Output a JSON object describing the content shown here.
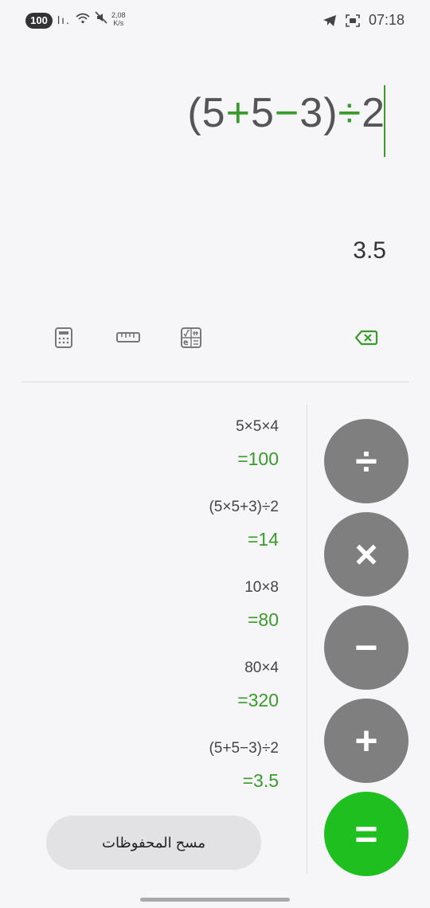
{
  "status_bar": {
    "battery": "100",
    "signal_text": "lı.",
    "net_speed_value": "2,08",
    "net_speed_unit": "K/s",
    "time": "07:18"
  },
  "display": {
    "expression_parts": [
      "(5",
      "+",
      "5",
      "−",
      "3)",
      "÷",
      "2"
    ],
    "result": "3.5"
  },
  "history": [
    {
      "expression": "5×5×4",
      "result": "=100"
    },
    {
      "expression": "(5×5+3)÷2",
      "result": "=14"
    },
    {
      "expression": "10×8",
      "result": "=80"
    },
    {
      "expression": "80×4",
      "result": "=320"
    },
    {
      "expression": "(5+5−3)÷2",
      "result": "=3.5"
    }
  ],
  "operators": {
    "divide": "÷",
    "multiply": "×",
    "minus": "−",
    "plus": "+",
    "equals": "="
  },
  "clear_history_label": "مسح المحفوظات",
  "colors": {
    "accent_green": "#3a9b2c",
    "equals_button": "#1fbf1f",
    "operator_button": "#7f7f7f",
    "background": "#f6f6f8"
  }
}
